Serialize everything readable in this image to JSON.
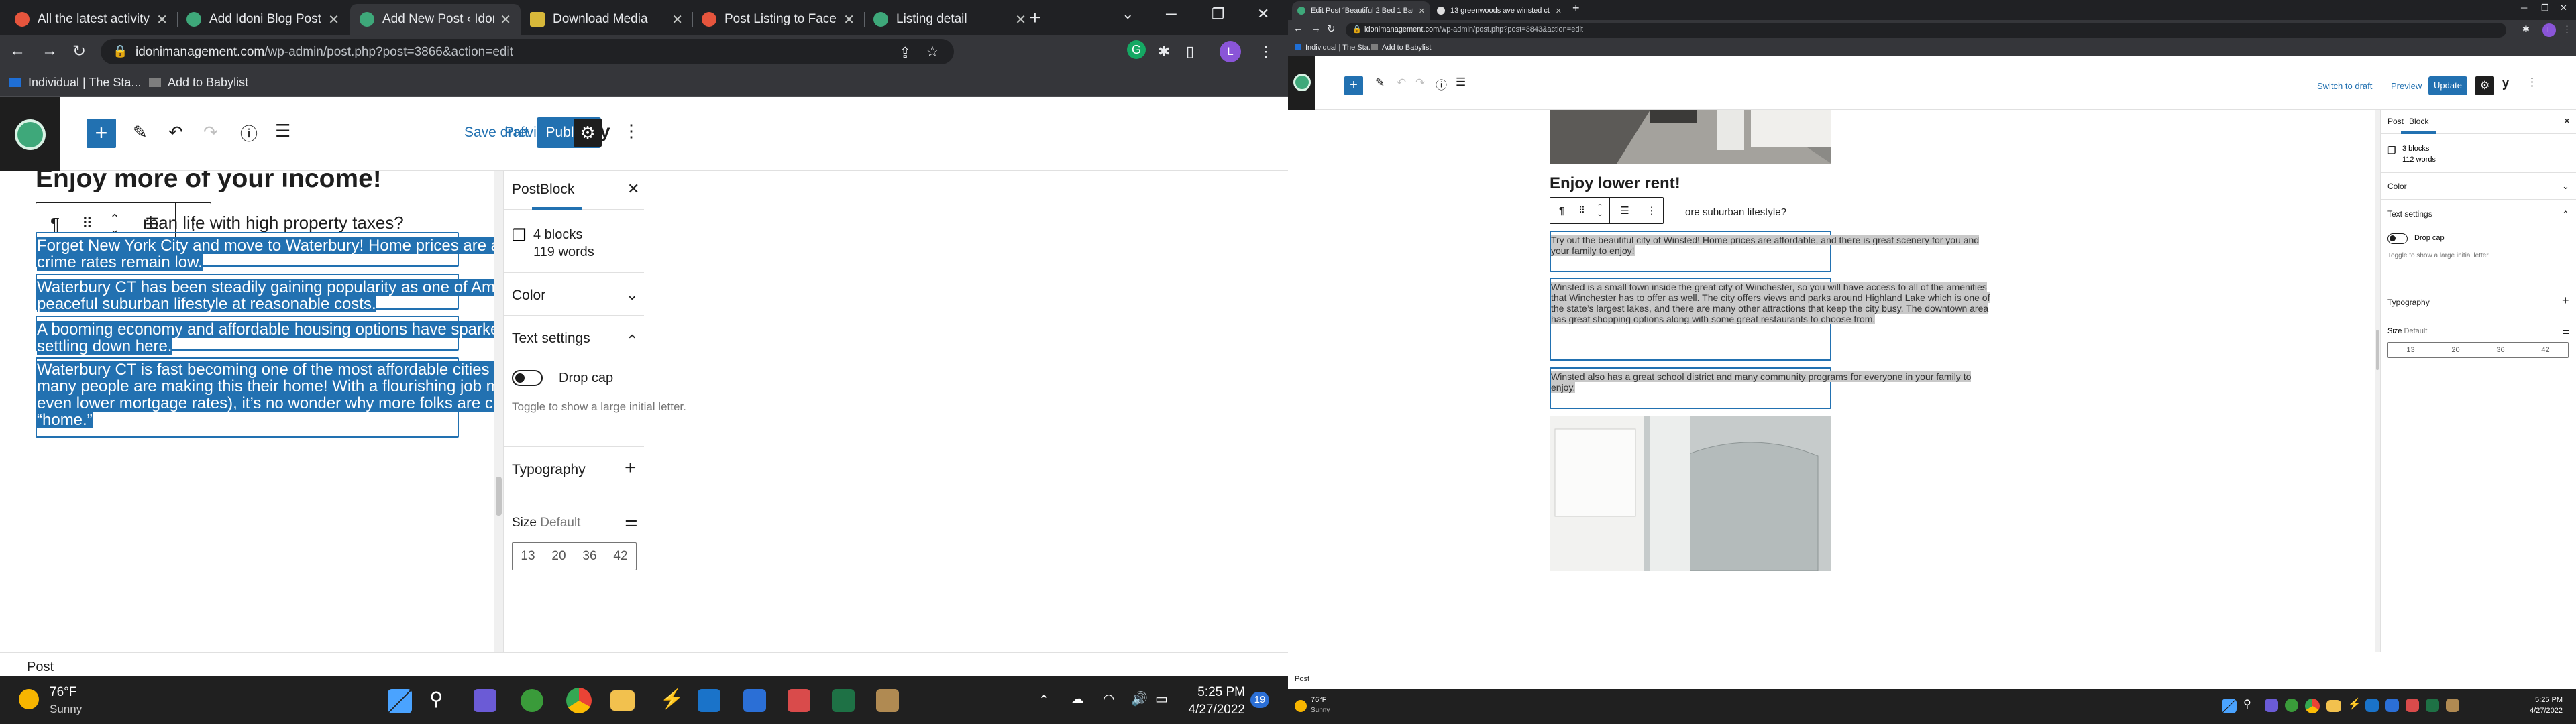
{
  "left_window": {
    "tabs": [
      {
        "title": "All the latest activity",
        "color": "#e6553d"
      },
      {
        "title": "Add Idoni Blog Post",
        "color": "#3ea87a"
      },
      {
        "title": "Add New Post ‹ Idoni",
        "color": "#3ea87a"
      },
      {
        "title": "Download Media",
        "color": "#d7b83a"
      },
      {
        "title": "Post Listing to Face",
        "color": "#e6553d"
      },
      {
        "title": "Listing detail",
        "color": "#3ea87a"
      }
    ],
    "url_domain": "idonimanagement.com",
    "url_path": "/wp-admin/post.php?post=3866&action=edit",
    "profile_letter": "L",
    "bookmarks": [
      "Individual | The Sta...",
      "Add to Babylist"
    ],
    "editor": {
      "save_draft": "Save draft",
      "preview": "Preview",
      "publish": "Publish",
      "yoast": "y",
      "heading": "Enjoy more of your income!",
      "partial_para": "rban life with high property taxes?",
      "blocks": [
        [
          "Forget New York City and move to Waterbury! Home prices are affordable, the scenery is beautiful, and",
          "crime rates remain low."
        ],
        [
          "Waterbury CT has been steadily gaining popularity as one of America’s best cities for families who want a",
          "peaceful suburban lifestyle at reasonable costs."
        ],
        [
          "A booming economy and affordable housing options have sparked a significant growth in families",
          "settling down here."
        ],
        [
          "Waterbury CT is fast becoming one of the most affordable cities to live in the North East. So much, that",
          "many people are making this their home! With a flourishing job market coupled with low living costs (and",
          "even lower mortgage rates), it’s no wonder why more folks are choosing Waterbury as their place to call",
          "“home.”"
        ]
      ],
      "sidebar": {
        "tab_post": "Post",
        "tab_block": "Block",
        "blocks_count": "4 blocks",
        "words_count": "119 words",
        "color": "Color",
        "text_settings": "Text settings",
        "drop_cap": "Drop cap",
        "drop_cap_help": "Toggle to show a large initial letter.",
        "typography": "Typography",
        "size_label": "Size",
        "size_value": "Default",
        "sizes": [
          "13",
          "20",
          "36",
          "42"
        ]
      },
      "status": "Post"
    }
  },
  "right_window": {
    "tabs": [
      {
        "title": "Edit Post “Beautiful 2 Bed 1 Bath",
        "color": "#3ea87a"
      },
      {
        "title": "13 greenwoods ave winsted ct",
        "color": "#dddddd"
      }
    ],
    "url_domain": "idonimanagement.com",
    "url_path": "/wp-admin/post.php?post=3843&action=edit",
    "bookmarks": [
      "Individual | The Sta...",
      "Add to Babylist"
    ],
    "editor": {
      "switch_draft": "Switch to draft",
      "preview": "Preview",
      "update": "Update",
      "heading": "Enjoy lower rent!",
      "partial_para": "ore suburban lifestyle?",
      "blocks": [
        [
          "Try out the beautiful city of Winsted! Home prices are affordable, and there is great scenery for you and",
          "your family to enjoy!"
        ],
        [
          "Winsted is a small town inside the great city of Winchester, so you will have access to all of the amenities",
          "that Winchester has to offer as well. The city offers views and parks around Highland Lake which is one of",
          "the state’s largest lakes, and there are many other attractions that keep the city busy. The downtown area",
          "has great shopping options along with some great restaurants to choose from."
        ],
        [
          "Winsted also has a great school district and many community programs for everyone in your family to",
          "enjoy."
        ]
      ],
      "sidebar": {
        "tab_post": "Post",
        "tab_block": "Block",
        "blocks_count": "3 blocks",
        "words_count": "112 words",
        "color": "Color",
        "text_settings": "Text settings",
        "drop_cap": "Drop cap",
        "drop_cap_help": "Toggle to show a large initial letter.",
        "typography": "Typography",
        "size_label": "Size",
        "size_value": "Default",
        "sizes": [
          "13",
          "20",
          "36",
          "42"
        ]
      },
      "status": "Post"
    }
  },
  "taskbar_left": {
    "temp": "76°F",
    "weather": "Sunny",
    "time": "5:25 PM",
    "date": "4/27/2022",
    "badge": "19"
  },
  "taskbar_right": {
    "temp": "76°F",
    "weather": "Sunny",
    "time": "5:25 PM",
    "date": "4/27/2022"
  }
}
